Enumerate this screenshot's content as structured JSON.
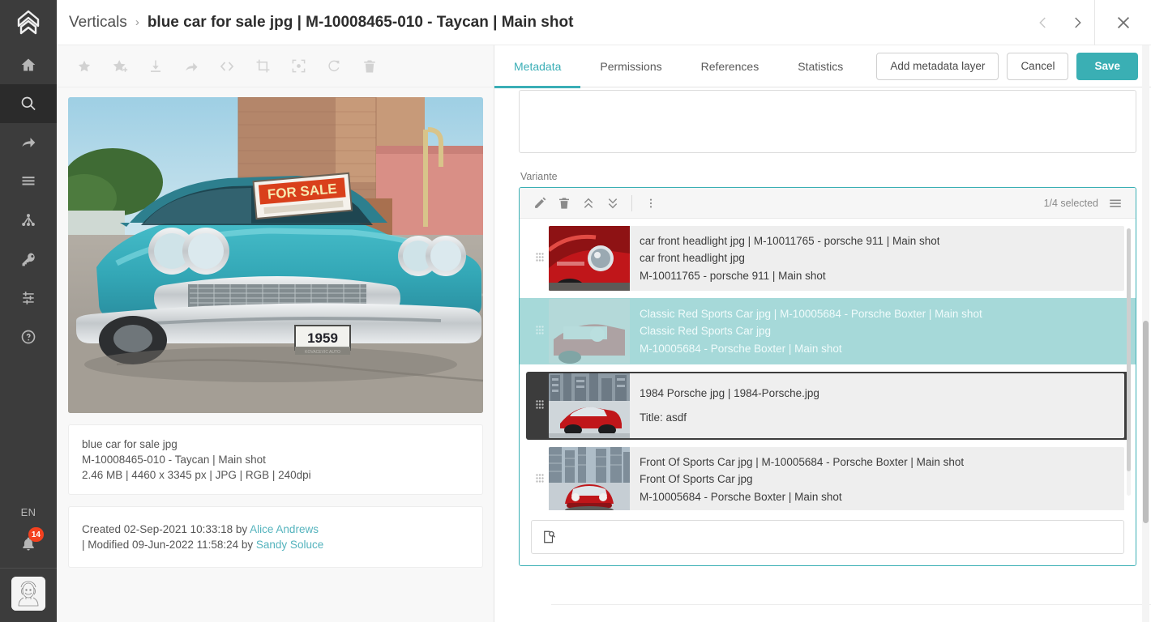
{
  "app": {
    "logo_icon": "brand-logo-icon",
    "accent_color": "#3aafb4",
    "badge_color": "#f4411f"
  },
  "sidebar": {
    "items": [
      {
        "icon": "home-icon",
        "name": "home",
        "active": false
      },
      {
        "icon": "search-icon",
        "name": "search",
        "active": true
      },
      {
        "icon": "share-arrow-icon",
        "name": "share",
        "active": false
      },
      {
        "icon": "list-lines-icon",
        "name": "jobs",
        "active": false
      },
      {
        "icon": "hierarchy-tree-icon",
        "name": "taxonomy",
        "active": false
      },
      {
        "icon": "key-icon",
        "name": "permissions",
        "active": false
      },
      {
        "icon": "sliders-icon",
        "name": "settings",
        "active": false
      },
      {
        "icon": "help-circle-icon",
        "name": "help",
        "active": false
      }
    ],
    "language": "EN",
    "notifications": {
      "icon": "bell-icon",
      "count": "14"
    },
    "avatar_alt": "user-avatar"
  },
  "header": {
    "breadcrumb_root": "Verticals",
    "breadcrumb_separator": "›",
    "breadcrumb_current": "blue car for sale jpg | M-10008465-010 - Taycan | Main shot",
    "prev_icon": "chevron-left-icon",
    "next_icon": "chevron-right-icon",
    "close_icon": "close-icon"
  },
  "asset_toolbar": {
    "buttons": [
      {
        "icon": "star-icon",
        "name": "favorite"
      },
      {
        "icon": "star-plus-icon",
        "name": "add-to-collection"
      },
      {
        "icon": "download-icon",
        "name": "download"
      },
      {
        "icon": "share-arrow-icon",
        "name": "share"
      },
      {
        "icon": "code-brackets-icon",
        "name": "embed-code"
      },
      {
        "icon": "crop-icon",
        "name": "crop"
      },
      {
        "icon": "focus-frame-icon",
        "name": "focus-point"
      },
      {
        "icon": "refresh-icon",
        "name": "replace-asset"
      },
      {
        "icon": "trash-icon",
        "name": "delete"
      }
    ]
  },
  "preview": {
    "alt": "1959 turquoise classic car with FOR SALE sign",
    "sign_text": "FOR SALE",
    "plate_text": "1959",
    "plate_sub": "KOVACEVIC AUTO"
  },
  "asset_info": {
    "filename": "blue car for sale jpg",
    "identifier": "M-10008465-010 - Taycan | Main shot",
    "tech": "2.46 MB | 4460 x 3345 px | JPG | RGB | 240dpi"
  },
  "audit": {
    "created": "Created 02-Sep-2021 10:33:18 by ",
    "created_by": "Alice Andrews",
    "modified": "| Modified 09-Jun-2022 11:58:24 by ",
    "modified_by": "Sandy Soluce"
  },
  "tabs": [
    {
      "label": "Metadata",
      "active": true
    },
    {
      "label": "Permissions",
      "active": false
    },
    {
      "label": "References",
      "active": false
    },
    {
      "label": "Statistics",
      "active": false
    }
  ],
  "tab_actions": {
    "add_layer": "Add metadata layer",
    "cancel": "Cancel",
    "save": "Save"
  },
  "variant_field": {
    "label": "Variante",
    "toolbar": {
      "edit_icon": "pencil-icon",
      "delete_icon": "trash-icon",
      "move_top_icon": "double-chevron-up-icon",
      "move_bottom_icon": "double-chevron-down-icon",
      "more_icon": "more-vertical-icon",
      "selected_count": "1/4 selected",
      "menu_icon": "hamburger-menu-icon"
    },
    "rows": [
      {
        "state": "normal",
        "handle_icon": "drag-handle-icon",
        "thumb": "red-porsche-911-headlight",
        "line1": "car front headlight jpg | M-10011765 - porsche 911 | Main shot",
        "line2": "car front headlight jpg",
        "line3": "M-10011765 - porsche 911 | Main shot"
      },
      {
        "state": "dragging",
        "handle_icon": "drag-handle-icon",
        "thumb": "classic-red-sports-car",
        "line1": "Classic Red Sports Car jpg | M-10005684 - Porsche Boxter | Main shot",
        "line2": "Classic Red Sports Car jpg",
        "line3": "M-10005684 - Porsche Boxter | Main shot"
      },
      {
        "state": "drop-target",
        "handle_icon": "drag-handle-icon",
        "thumb": "1984-porsche-city",
        "line1": "1984 Porsche jpg | 1984-Porsche.jpg",
        "line2": "Title: asdf",
        "line3": ""
      },
      {
        "state": "normal",
        "handle_icon": "drag-handle-icon",
        "thumb": "front-of-sports-car",
        "line1": "Front Of Sports Car jpg | M-10005684 - Porsche Boxter | Main shot",
        "line2": "Front Of Sports Car jpg",
        "line3": "M-10005684 - Porsche Boxter | Main shot"
      },
      {
        "state": "partial",
        "handle_icon": "drag-handle-icon",
        "thumb": "",
        "line1": "",
        "line2": "",
        "line3": ""
      }
    ],
    "search": {
      "icon": "document-search-icon",
      "value": "",
      "placeholder": ""
    }
  }
}
